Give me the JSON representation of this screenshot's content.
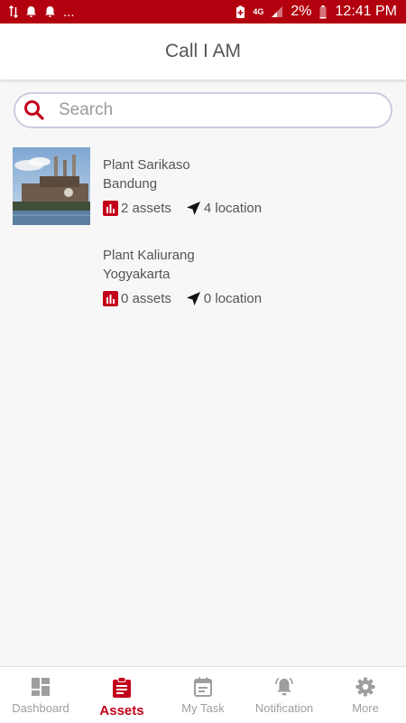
{
  "status_bar": {
    "network_label": "4G",
    "battery": "2%",
    "time": "12:41 PM",
    "overflow": "..."
  },
  "header": {
    "title": "Call I AM"
  },
  "search": {
    "placeholder": "Search",
    "value": ""
  },
  "plants": [
    {
      "name": "Plant Sarikaso",
      "city": "Bandung",
      "assets": "2 assets",
      "locations": "4 location",
      "has_image": true
    },
    {
      "name": "Plant Kaliurang",
      "city": "Yogyakarta",
      "assets": "0 assets",
      "locations": "0 location",
      "has_image": false
    }
  ],
  "nav": {
    "tabs": [
      {
        "label": "Dashboard",
        "icon": "dashboard-icon",
        "active": false
      },
      {
        "label": "Assets",
        "icon": "clipboard-icon",
        "active": true
      },
      {
        "label": "My Task",
        "icon": "calendar-icon",
        "active": false
      },
      {
        "label": "Notification",
        "icon": "bell-icon",
        "active": false
      },
      {
        "label": "More",
        "icon": "gear-icon",
        "active": false
      }
    ]
  },
  "colors": {
    "brand": "#b3000f",
    "accent": "#c3001a",
    "inactive": "#9e9e9e"
  }
}
